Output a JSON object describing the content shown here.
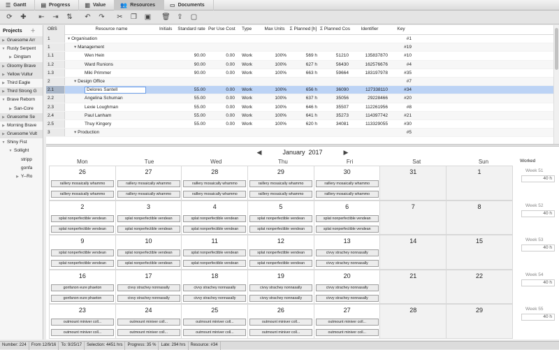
{
  "tabs": [
    {
      "label": "Gantt",
      "icon": "gantt-icon"
    },
    {
      "label": "Progress",
      "icon": "progress-icon"
    },
    {
      "label": "Value",
      "icon": "value-icon"
    },
    {
      "label": "Resources",
      "icon": "resources-icon",
      "active": true
    },
    {
      "label": "Documents",
      "icon": "documents-icon"
    }
  ],
  "toolbar": [
    "refresh-icon",
    "add-resource-icon",
    "outdent-icon",
    "indent-icon",
    "sort-icon",
    "undo-icon",
    "redo-icon",
    "cut-icon",
    "copy-icon",
    "paste-icon",
    "delete-icon",
    "export-icon",
    "window-icon"
  ],
  "sidebar": {
    "title": "Projects",
    "items": [
      {
        "label": "Gruesome Arr",
        "indent": 0,
        "tri": "▶",
        "alt": true
      },
      {
        "label": "Rusty Serpent",
        "indent": 0,
        "tri": "▼"
      },
      {
        "label": "Dingtam",
        "indent": 1,
        "tri": "▶"
      },
      {
        "label": "Gloomy Brave",
        "indent": 0,
        "tri": "▶",
        "alt": true
      },
      {
        "label": "Yellow Vultur",
        "indent": 0,
        "tri": "▶",
        "alt": true
      },
      {
        "label": "Third Eagle",
        "indent": 0,
        "tri": "▶"
      },
      {
        "label": "Third Strong G",
        "indent": 0,
        "tri": "▶",
        "alt": true
      },
      {
        "label": "Brave Reborn",
        "indent": 0,
        "tri": "▼"
      },
      {
        "label": "San-Core",
        "indent": 1,
        "tri": "▶"
      },
      {
        "label": "Gruesome Se",
        "indent": 0,
        "tri": "▶",
        "alt": true
      },
      {
        "label": "Morning Brave",
        "indent": 0,
        "tri": "▶"
      },
      {
        "label": "Gruesome Vult",
        "indent": 0,
        "tri": "▶",
        "alt": true
      },
      {
        "label": "Shiny Fist",
        "indent": 0,
        "tri": "▼"
      },
      {
        "label": "Sollight",
        "indent": 1,
        "tri": "▼"
      },
      {
        "label": "stripp",
        "indent": 2,
        "tri": ""
      },
      {
        "label": "gonfa",
        "indent": 2,
        "tri": ""
      },
      {
        "label": "Y--Ro",
        "indent": 2,
        "tri": "▶"
      }
    ]
  },
  "grid": {
    "headers": {
      "obs": "OBS",
      "name": "Resource name",
      "initials": "Initials",
      "std": "Standard rate",
      "puc": "Per Use Cost",
      "type": "Type",
      "max": "Max Units",
      "planned": "Σ Planned [h]",
      "pcost": "Σ Planned Cost",
      "id": "Identifier",
      "key": "Key"
    },
    "rows": [
      {
        "obs": "1",
        "tri": "◢",
        "name": "Organisation",
        "indent": 0,
        "std": "",
        "puc": "",
        "type": "",
        "max": "",
        "planned": "",
        "pcost": "",
        "id": "",
        "key": "#1"
      },
      {
        "obs": "1",
        "tri": "◢",
        "name": "Management",
        "indent": 1,
        "std": "",
        "puc": "",
        "type": "",
        "max": "",
        "planned": "",
        "pcost": "",
        "id": "",
        "key": "#19"
      },
      {
        "obs": "1.1",
        "tri": "",
        "name": "Wen Hein",
        "indent": 2,
        "std": "90.00",
        "puc": "0.00",
        "type": "Work",
        "max": "100%",
        "planned": "569 h",
        "pcost": "51210",
        "id": "135837870",
        "key": "#10"
      },
      {
        "obs": "1.2",
        "tri": "",
        "name": "Ward Runions",
        "indent": 2,
        "std": "90.00",
        "puc": "0.00",
        "type": "Work",
        "max": "100%",
        "planned": "627 h",
        "pcost": "56430",
        "id": "162576676",
        "key": "#4"
      },
      {
        "obs": "1.3",
        "tri": "",
        "name": "Miki Primmer",
        "indent": 2,
        "std": "90.00",
        "puc": "0.00",
        "type": "Work",
        "max": "100%",
        "planned": "663 h",
        "pcost": "59664",
        "id": "183197978",
        "key": "#35"
      },
      {
        "obs": "2",
        "tri": "◢",
        "name": "Design Office",
        "indent": 1,
        "std": "",
        "puc": "",
        "type": "",
        "max": "",
        "planned": "",
        "pcost": "",
        "id": "",
        "key": "#7"
      },
      {
        "obs": "2.1",
        "tri": "",
        "name": "Delores Santell",
        "indent": 2,
        "std": "55.00",
        "puc": "0.00",
        "type": "Work",
        "max": "100%",
        "planned": "656 h",
        "pcost": "36090",
        "id": "127338110",
        "key": "#34",
        "selected": true
      },
      {
        "obs": "2.2",
        "tri": "",
        "name": "Angelina Schuman",
        "indent": 2,
        "std": "55.00",
        "puc": "0.00",
        "type": "Work",
        "max": "100%",
        "planned": "637 h",
        "pcost": "35056",
        "id": "29228466",
        "key": "#20"
      },
      {
        "obs": "2.3",
        "tri": "",
        "name": "Lexie Loughman",
        "indent": 2,
        "std": "55.00",
        "puc": "0.00",
        "type": "Work",
        "max": "100%",
        "planned": "646 h",
        "pcost": "35507",
        "id": "112261956",
        "key": "#8"
      },
      {
        "obs": "2.4",
        "tri": "",
        "name": "Paul Lanham",
        "indent": 2,
        "std": "55.00",
        "puc": "0.00",
        "type": "Work",
        "max": "100%",
        "planned": "641 h",
        "pcost": "35273",
        "id": "114397742",
        "key": "#21"
      },
      {
        "obs": "2.5",
        "tri": "",
        "name": "Thuy Kingery",
        "indent": 2,
        "std": "55.00",
        "puc": "0.00",
        "type": "Work",
        "max": "100%",
        "planned": "620 h",
        "pcost": "34081",
        "id": "113329055",
        "key": "#30"
      },
      {
        "obs": "3",
        "tri": "◢",
        "name": "Production",
        "indent": 1,
        "std": "",
        "puc": "",
        "type": "",
        "max": "",
        "planned": "",
        "pcost": "",
        "id": "",
        "key": "#5"
      }
    ]
  },
  "calendar": {
    "month": "January",
    "year": "2017",
    "days": [
      "Mon",
      "Tue",
      "Wed",
      "Thu",
      "Fri",
      "Sat",
      "Sun"
    ],
    "worked_label": "Worked",
    "weeks": [
      {
        "label": "Week 51",
        "worked": "40 h",
        "dates": [
          "26",
          "27",
          "28",
          "29",
          "30",
          "31",
          "1"
        ],
        "events": [
          "raillery mosaically whammo",
          "raillery mosaically whammo",
          "raillery mosaically whammo",
          "raillery mosaically whammo",
          "raillery mosaically whammo"
        ]
      },
      {
        "label": "Week 52",
        "worked": "40 h",
        "dates": [
          "2",
          "3",
          "4",
          "5",
          "6",
          "7",
          "8"
        ],
        "events": [
          "splat nonperfectible vendean",
          "splat nonperfectible vendean",
          "splat nonperfectible vendean",
          "splat nonperfectible vendean",
          "splat nonperfectible vendean"
        ]
      },
      {
        "label": "Week 53",
        "worked": "40 h",
        "dates": [
          "9",
          "10",
          "11",
          "12",
          "13",
          "14",
          "15"
        ],
        "events": [
          "splat nonperfectible vendean",
          "splat nonperfectible vendean",
          "splat nonperfectible vendean",
          "splat nonperfectible vendean",
          "civvy strachey nonnasally"
        ]
      },
      {
        "label": "Week 54",
        "worked": "40 h",
        "dates": [
          "16",
          "17",
          "18",
          "19",
          "20",
          "21",
          "22"
        ],
        "events": [
          "gonfanon eure phaeton",
          "civvy strachey nonnasally",
          "civvy strachey nonnasally",
          "civvy strachey nonnasally",
          "civvy strachey nonnasally"
        ]
      },
      {
        "label": "Week 55",
        "worked": "40 h",
        "dates": [
          "23",
          "24",
          "25",
          "26",
          "27",
          "28",
          "29"
        ],
        "events": [
          "outmount miniver coll...",
          "outmount miniver coll...",
          "outmount miniver coll...",
          "outmount miniver coll...",
          "outmount miniver coll..."
        ]
      }
    ]
  },
  "status": {
    "number": "Number: 224",
    "from": "From 12/9/16",
    "to": "To: 9/25/17",
    "selection": "Selection: 4451 hrs",
    "progress": "Progress: 35 %",
    "late": "Late: 294 hrs",
    "resource": "Resource: #34"
  }
}
